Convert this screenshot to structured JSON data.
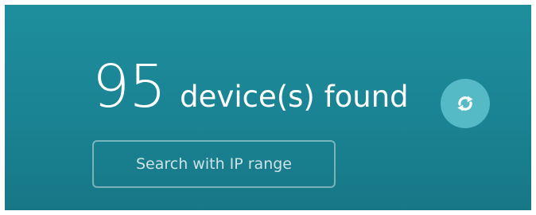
{
  "scan_result": {
    "count": "95",
    "label": "device(s) found"
  },
  "refresh": {
    "icon": "refresh-icon"
  },
  "ip_search": {
    "label": "Search with IP range"
  },
  "colors": {
    "panel_background": "#1a8393",
    "refresh_button": "#56b9c6",
    "text": "#ffffff"
  }
}
